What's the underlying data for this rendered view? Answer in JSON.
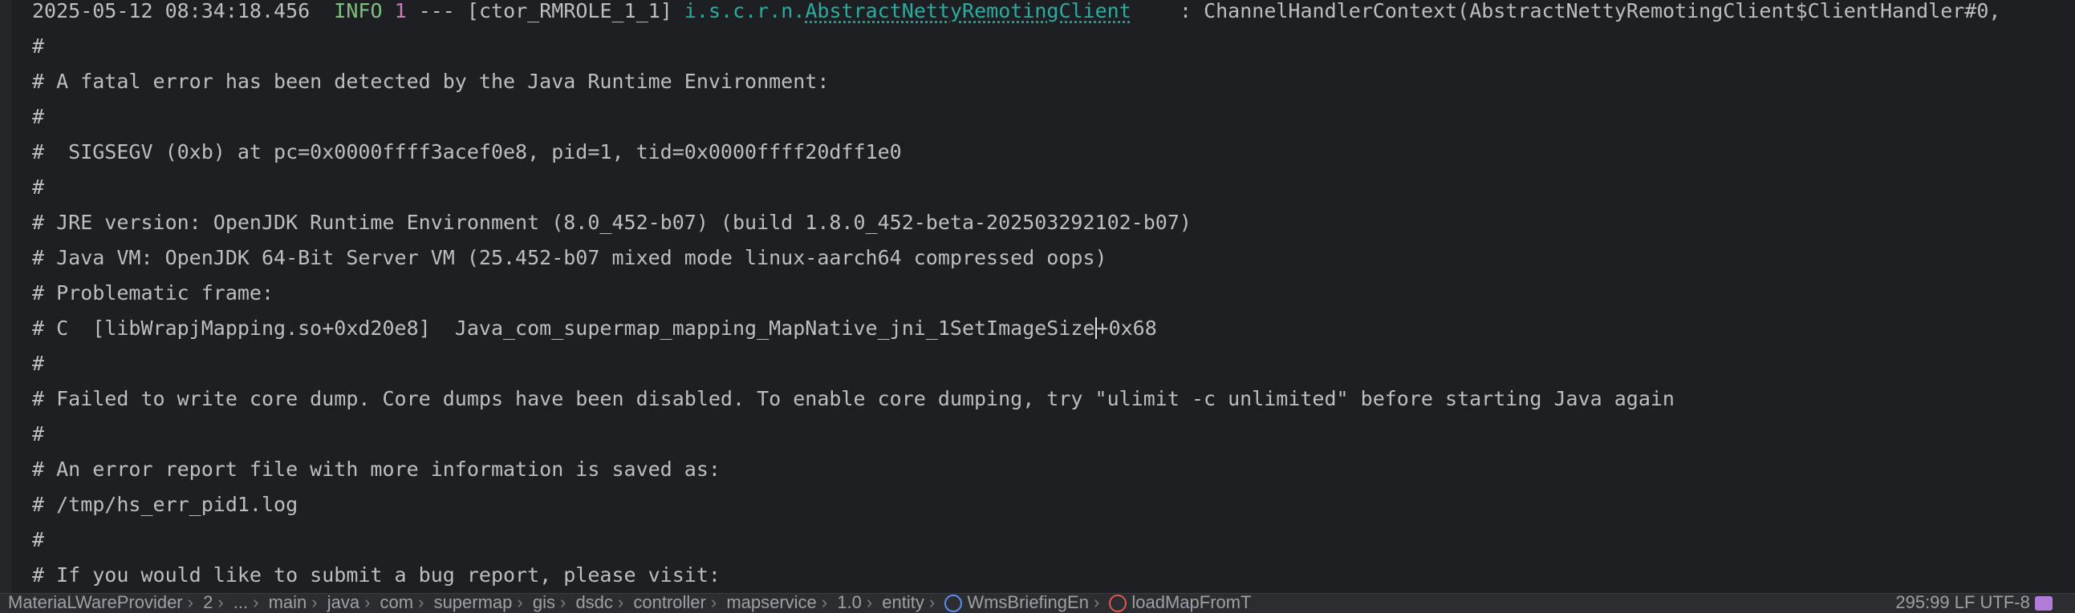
{
  "console": {
    "header": {
      "timestamp": "2025-05-12 08:34:18.456",
      "level": "INFO",
      "pid": "1",
      "separator": "---",
      "thread": "[ctor_RMROLE_1_1]",
      "logger_package": "i.s.c.r.n.",
      "logger_class": "AbstractNettyRemotingClient",
      "message": "    : ChannelHandlerContext(AbstractNettyRemotingClient$ClientHandler#0,"
    },
    "lines": [
      "#",
      "# A fatal error has been detected by the Java Runtime Environment:",
      "#",
      "#  SIGSEGV (0xb) at pc=0x0000ffff3acef0e8, pid=1, tid=0x0000ffff20dff1e0",
      "#",
      "# JRE version: OpenJDK Runtime Environment (8.0_452-b07) (build 1.8.0_452-beta-202503292102-b07)",
      "# Java VM: OpenJDK 64-Bit Server VM (25.452-b07 mixed mode linux-aarch64 compressed oops)",
      "# Problematic frame:"
    ],
    "caret_line": {
      "before": "# C  [libWrapjMapping.so+0xd20e8]  Java_com_supermap_mapping_MapNative_jni_1SetImageSize",
      "after": "+0x68"
    },
    "lines_after": [
      "#",
      "# Failed to write core dump. Core dumps have been disabled. To enable core dumping, try \"ulimit -c unlimited\" before starting Java again",
      "#",
      "# An error report file with more information is saved as:",
      "# /tmp/hs_err_pid1.log",
      "#",
      "# If you would like to submit a bug report, please visit:"
    ]
  },
  "status_bar": {
    "crumbs": [
      "MateriaLWareProvider",
      "2",
      "...",
      "main",
      "java",
      "com",
      "supermap",
      "gis",
      "dsdc",
      "controller",
      "mapservice",
      "1.0",
      "entity"
    ],
    "class_label": "WmsBriefingEn",
    "method_label": "loadMapFromT",
    "right_text": "295:99   LF   UTF-8",
    "colors": {
      "class_icon": "#5c8df6",
      "method_icon": "#e05555",
      "plugin_icon": "#b07cd8"
    }
  }
}
